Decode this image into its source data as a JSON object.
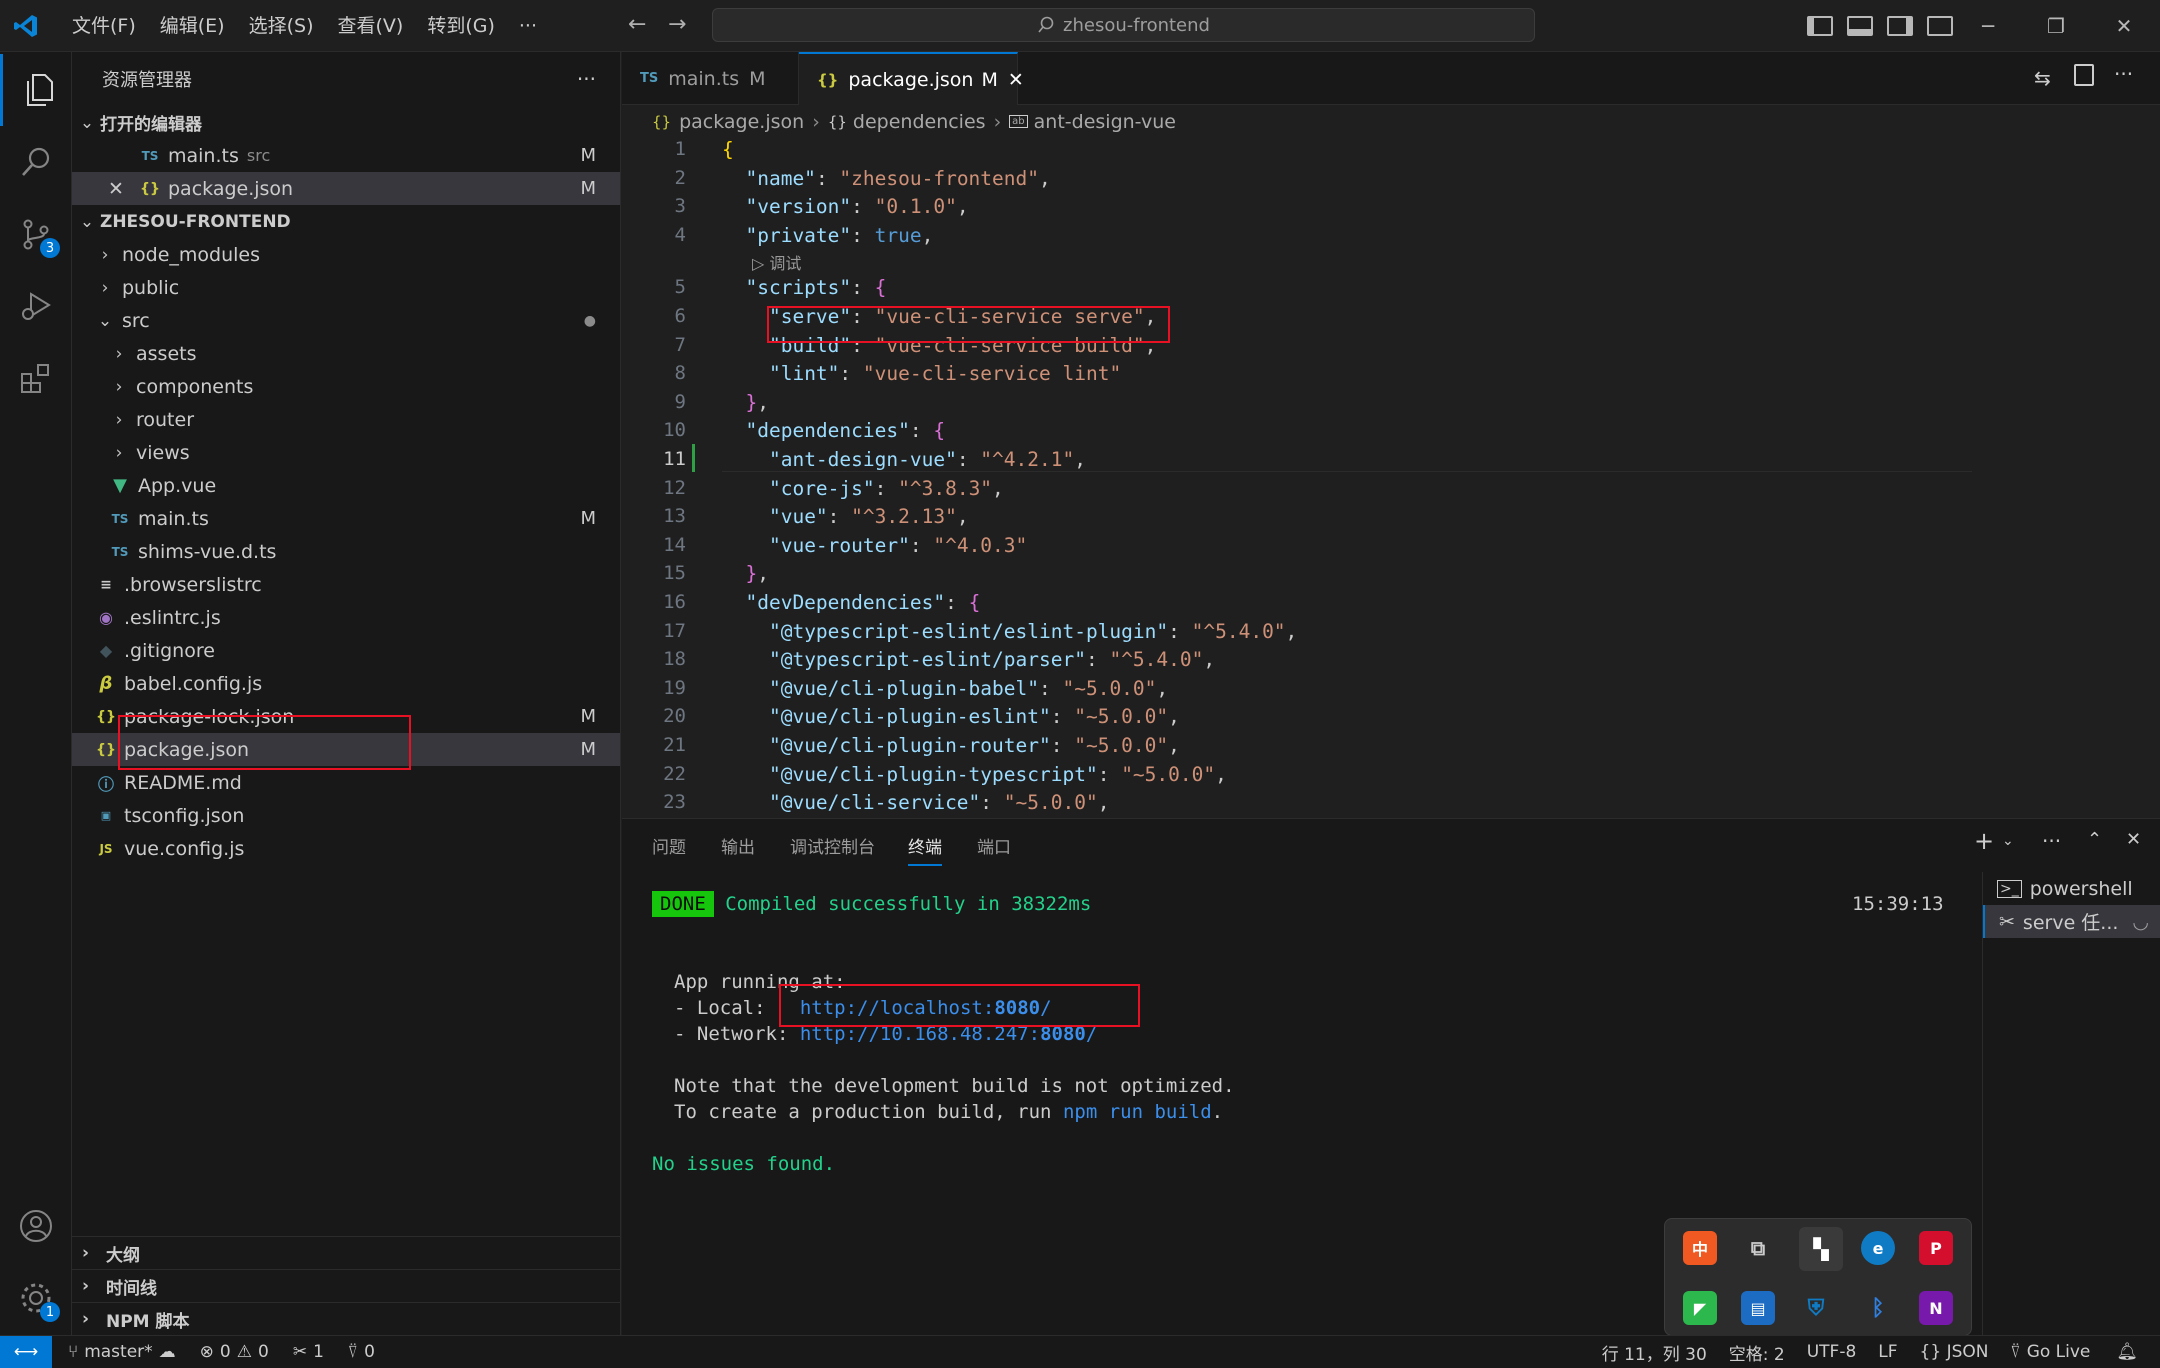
{
  "titlebar": {
    "menus": [
      "文件(F)",
      "编辑(E)",
      "选择(S)",
      "查看(V)",
      "转到(G)",
      "···"
    ],
    "search_text": "zhesou-frontend"
  },
  "activitybar": {
    "scm_badge": "3",
    "settings_badge": "1"
  },
  "sidebar": {
    "title": "资源管理器",
    "more": "···",
    "open_editors_title": "打开的编辑器",
    "open_editors": [
      {
        "icon": "TS",
        "name": "main.ts",
        "sub": "src",
        "mark": "M"
      },
      {
        "icon": "{}",
        "name": "package.json",
        "sub": "",
        "mark": "M"
      }
    ],
    "project_title": "ZHESOU-FRONTEND",
    "tree": [
      {
        "name": "node_modules",
        "mark": ""
      },
      {
        "name": "public",
        "mark": ""
      },
      {
        "name": "src",
        "mark": "●"
      },
      {
        "name": "assets",
        "mark": ""
      },
      {
        "name": "components",
        "mark": ""
      },
      {
        "name": "router",
        "mark": ""
      },
      {
        "name": "views",
        "mark": ""
      },
      {
        "name": "App.vue",
        "mark": ""
      },
      {
        "name": "main.ts",
        "mark": "M"
      },
      {
        "name": "shims-vue.d.ts",
        "mark": ""
      },
      {
        "name": ".browserslistrc",
        "mark": ""
      },
      {
        "name": ".eslintrc.js",
        "mark": ""
      },
      {
        "name": ".gitignore",
        "mark": ""
      },
      {
        "name": "babel.config.js",
        "mark": ""
      },
      {
        "name": "package-lock.json",
        "mark": "M"
      },
      {
        "name": "package.json",
        "mark": "M"
      },
      {
        "name": "README.md",
        "mark": ""
      },
      {
        "name": "tsconfig.json",
        "mark": ""
      },
      {
        "name": "vue.config.js",
        "mark": ""
      }
    ],
    "outline": "大纲",
    "timeline": "时间线",
    "npm_scripts": "NPM 脚本"
  },
  "tabs": [
    {
      "icon": "TS",
      "label": "main.ts",
      "mark": "M"
    },
    {
      "icon": "{}",
      "label": "package.json",
      "mark": "M",
      "close": "✕"
    }
  ],
  "breadcrumb": [
    "package.json",
    "dependencies",
    "ant-design-vue"
  ],
  "codelens": "调试",
  "code": {
    "line_numbers": [
      "1",
      "2",
      "3",
      "4",
      "5",
      "6",
      "7",
      "8",
      "9",
      "10",
      "11",
      "12",
      "13",
      "14",
      "15",
      "16",
      "17",
      "18",
      "19",
      "20",
      "21",
      "22",
      "23"
    ],
    "lines": [
      "{",
      "  \"name\": \"zhesou-frontend\",",
      "  \"version\": \"0.1.0\",",
      "  \"private\": true,",
      "  \"scripts\": {",
      "    \"serve\": \"vue-cli-service serve\",",
      "    \"build\": \"vue-cli-service build\",",
      "    \"lint\": \"vue-cli-service lint\"",
      "  },",
      "  \"dependencies\": {",
      "    \"ant-design-vue\": \"^4.2.1\",",
      "    \"core-js\": \"^3.8.3\",",
      "    \"vue\": \"^3.2.13\",",
      "    \"vue-router\": \"^4.0.3\"",
      "  },",
      "  \"devDependencies\": {",
      "    \"@typescript-eslint/eslint-plugin\": \"^5.4.0\",",
      "    \"@typescript-eslint/parser\": \"^5.4.0\",",
      "    \"@vue/cli-plugin-babel\": \"~5.0.0\",",
      "    \"@vue/cli-plugin-eslint\": \"~5.0.0\",",
      "    \"@vue/cli-plugin-router\": \"~5.0.0\",",
      "    \"@vue/cli-plugin-typescript\": \"~5.0.0\",",
      "    \"@vue/cli-service\": \"~5.0.0\","
    ]
  },
  "panel": {
    "tabs": [
      "问题",
      "输出",
      "调试控制台",
      "终端",
      "端口"
    ],
    "active_tab": "终端",
    "done_badge": "DONE",
    "compiled": "Compiled successfully in 38322ms",
    "time": "15:39:13",
    "app_running": "App running at:",
    "local_label": "- Local:   ",
    "local_url": "http://localhost:",
    "local_port": "8080",
    "network_label": "- Network: ",
    "network_url": "http://10.168.48.247:",
    "network_port": "8080",
    "note1": "Note that the development build is not optimized.",
    "note2_prefix": "To create a production build, run ",
    "note2_cmd": "npm run build",
    "note2_suffix": ".",
    "no_issues": "No issues found.",
    "terminals": [
      "powershell",
      "serve 任..."
    ]
  },
  "statusbar": {
    "branch": "master*",
    "errors": "0",
    "warnings": "0",
    "ports": "1",
    "broadcast": "0",
    "cursor": "行 11，列 30",
    "spaces": "空格: 2",
    "encoding": "UTF-8",
    "eol": "LF",
    "language": "{} JSON",
    "golive": "Go Live"
  },
  "colors": {
    "accent": "#0078d4",
    "annotation": "#e81123",
    "string": "#ce9178",
    "key": "#9cdcfe"
  }
}
